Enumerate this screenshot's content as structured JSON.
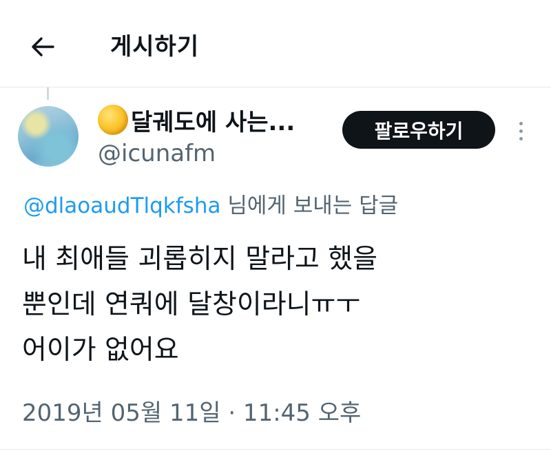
{
  "header": {
    "back_icon": "arrow-left-icon",
    "title": "게시하기"
  },
  "author": {
    "display_name": "달궤도에 사는...",
    "name_emoji_icon": "full-moon-icon",
    "handle": "@icunafm",
    "follow_label": "팔로우하기",
    "more_icon": "more-vertical-icon"
  },
  "reply": {
    "mention": "@dlaoaudTlqkfsha",
    "suffix": " 님에게 보내는 답글"
  },
  "tweet": {
    "lines": [
      "내 최애들 괴롭히지 말라고 했을",
      "뿐인데 연쿼에 달창이라니ㅠㅜ",
      "어이가 없어요"
    ]
  },
  "timestamp": "2019년 05월 11일 · 11:45 오후"
}
